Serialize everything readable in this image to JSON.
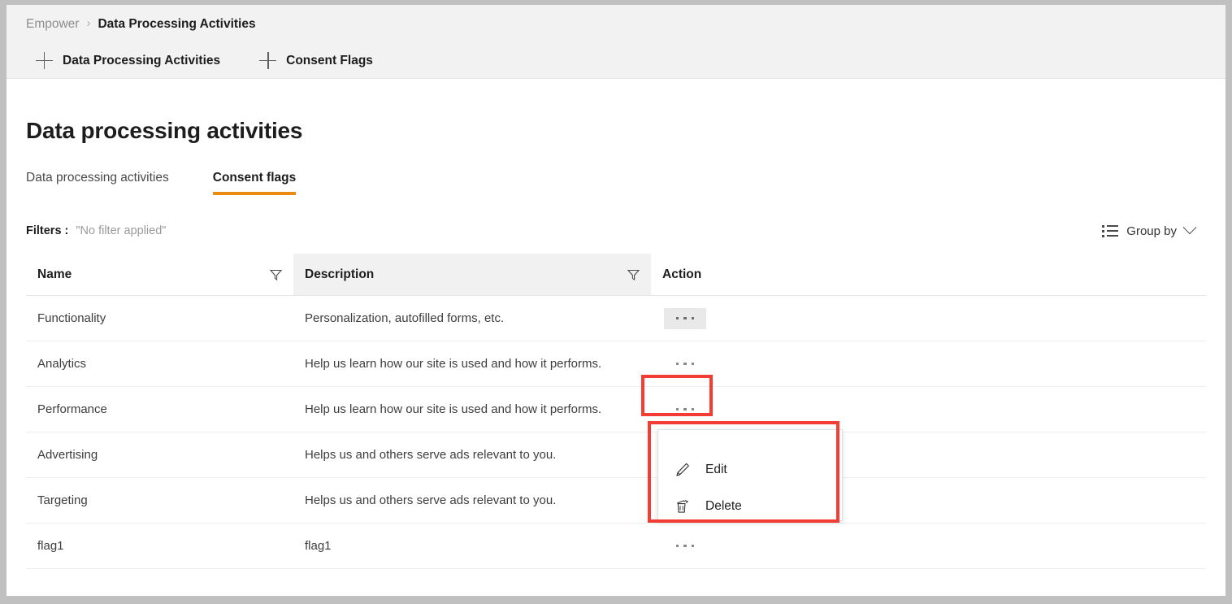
{
  "colors": {
    "accent_orange": "#ec8b12",
    "annotation_red": "#f23c34",
    "header_band": "#f2f2f2",
    "column_hover": "#f1f1f1",
    "text_primary": "#1d1d1d",
    "text_muted": "#9a9a9a"
  },
  "chrome": {
    "breadcrumb": {
      "root": "Empower",
      "separator": "›",
      "current": "Data Processing Activities"
    },
    "actions": [
      {
        "icon": "plus-icon",
        "label": "Data Processing Activities"
      },
      {
        "icon": "plus-icon",
        "label": "Consent Flags"
      }
    ]
  },
  "page": {
    "title": "Data processing activities",
    "tabs": [
      {
        "label": "Data processing activities",
        "active": false
      },
      {
        "label": "Consent flags",
        "active": true
      }
    ]
  },
  "filter_bar": {
    "label": "Filters :",
    "value": "\"No filter applied\"",
    "group_by": {
      "icon": "list-bullets-icon",
      "label": "Group by",
      "chevron": "chevron-down-icon"
    }
  },
  "table": {
    "columns": [
      {
        "key": "name",
        "header": "Name",
        "filter_icon": "funnel-icon",
        "hovered": false
      },
      {
        "key": "description",
        "header": "Description",
        "filter_icon": "funnel-icon",
        "hovered": true
      },
      {
        "key": "action",
        "header": "Action",
        "filter_icon": null,
        "hovered": false
      }
    ],
    "rows": [
      {
        "name": "Functionality",
        "description": "Personalization, autofilled forms, etc.",
        "action": "ellipsis-icon",
        "menu_open": true
      },
      {
        "name": "Analytics",
        "description": "Help us learn how our site is used and how it performs.",
        "action": "ellipsis-icon",
        "menu_open": false
      },
      {
        "name": "Performance",
        "description": "Help us learn how our site is used and how it performs.",
        "action": "ellipsis-icon",
        "menu_open": false
      },
      {
        "name": "Advertising",
        "description": "Helps us and others serve ads relevant to you.",
        "action": "ellipsis-icon",
        "menu_open": false
      },
      {
        "name": "Targeting",
        "description": "Helps us and others serve ads relevant to you.",
        "action": "ellipsis-icon",
        "menu_open": false
      },
      {
        "name": "flag1",
        "description": "flag1",
        "action": "ellipsis-icon",
        "menu_open": false
      }
    ]
  },
  "context_menu": {
    "items": [
      {
        "icon": "pencil-icon",
        "label": "Edit"
      },
      {
        "icon": "trash-icon",
        "label": "Delete"
      }
    ]
  },
  "annotations": [
    {
      "id": "annot-action",
      "target": "action-column-header"
    },
    {
      "id": "annot-menu",
      "target": "row-action-context-menu"
    }
  ]
}
